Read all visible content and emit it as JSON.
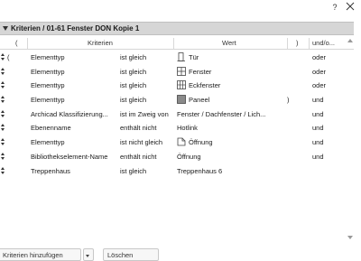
{
  "window": {
    "help_label": "?"
  },
  "section": {
    "title": "Kriterien / 01-61 Fenster DON Kopie 1"
  },
  "columns": {
    "open_paren": "(",
    "criteria": "Kriterien",
    "value": "Wert",
    "close_paren": ")",
    "andor": "und/o..."
  },
  "rows": [
    {
      "open": "(",
      "criterion": "Elementtyp",
      "op": "ist gleich",
      "icon": "door-icon",
      "value": "Tür",
      "close": "",
      "andor": "oder"
    },
    {
      "open": "",
      "criterion": "Elementtyp",
      "op": "ist gleich",
      "icon": "window-icon",
      "value": "Fenster",
      "close": "",
      "andor": "oder"
    },
    {
      "open": "",
      "criterion": "Elementtyp",
      "op": "ist gleich",
      "icon": "corner-window-icon",
      "value": "Eckfenster",
      "close": "",
      "andor": "oder"
    },
    {
      "open": "",
      "criterion": "Elementtyp",
      "op": "ist gleich",
      "icon": "panel-icon",
      "value": "Paneel",
      "close": ")",
      "andor": "und"
    },
    {
      "open": "",
      "criterion": "Archicad Klassifizierung...",
      "op": "ist im Zweig von",
      "icon": "",
      "value": "Fenster / Dachfenster / Lich...",
      "close": "",
      "andor": "und"
    },
    {
      "open": "",
      "criterion": "Ebenenname",
      "op": "enthält nicht",
      "icon": "",
      "value": "Hotlink",
      "close": "",
      "andor": "und"
    },
    {
      "open": "",
      "criterion": "Elementtyp",
      "op": "ist nicht gleich",
      "icon": "opening-icon",
      "value": "Öffnung",
      "close": "",
      "andor": "und"
    },
    {
      "open": "",
      "criterion": "Bibliothekselement-Name",
      "op": "enthält nicht",
      "icon": "",
      "value": "Öffnung",
      "close": "",
      "andor": "und"
    },
    {
      "open": "",
      "criterion": "Treppenhaus",
      "op": "ist gleich",
      "icon": "",
      "value": "Treppenhaus 6",
      "close": "",
      "andor": ""
    }
  ],
  "bottom": {
    "left_button": "Kriterien hinzufügen",
    "right_button": "Löschen"
  }
}
